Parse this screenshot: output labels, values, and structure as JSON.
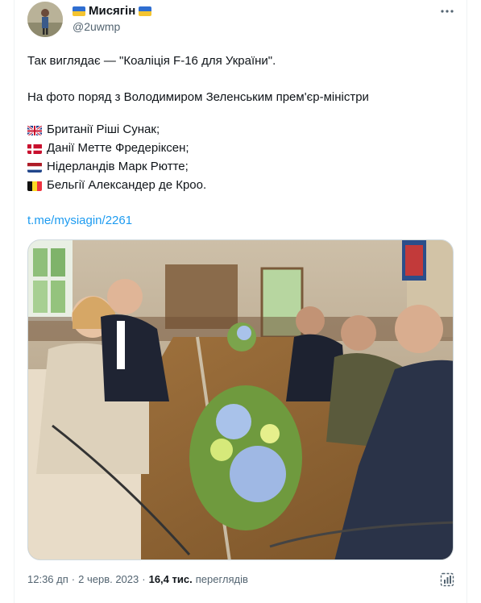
{
  "post": {
    "display_name": "Мисягін",
    "handle": "@2uwmp",
    "line1": "Так виглядає — \"Коаліція F-16 для України\".",
    "line2": "На фото поряд з Володимиром Зеленським прем'єр-міністри",
    "ministers": [
      {
        "flag": "uk-flag-icon",
        "text": "Британії Ріші Сунак;"
      },
      {
        "flag": "denmark-flag-icon",
        "text": "Данії Метте Фредеріксен;"
      },
      {
        "flag": "netherlands-flag-icon",
        "text": "Нідерландів Марк Рютте;"
      },
      {
        "flag": "belgium-flag-icon",
        "text": "Бельгії Александер де Кроо."
      }
    ],
    "link": "t.me/mysiagin/2261",
    "time": "12:36 дп",
    "dot": "·",
    "date": "2 черв. 2023",
    "dot2": "·",
    "views_count": "16,4 тис.",
    "views_label": "переглядів"
  },
  "colors": {
    "link": "#1d9bf0",
    "secondary": "#536471",
    "ukraine_blue": "#2f6ed1",
    "ukraine_yellow": "#f4c430"
  }
}
